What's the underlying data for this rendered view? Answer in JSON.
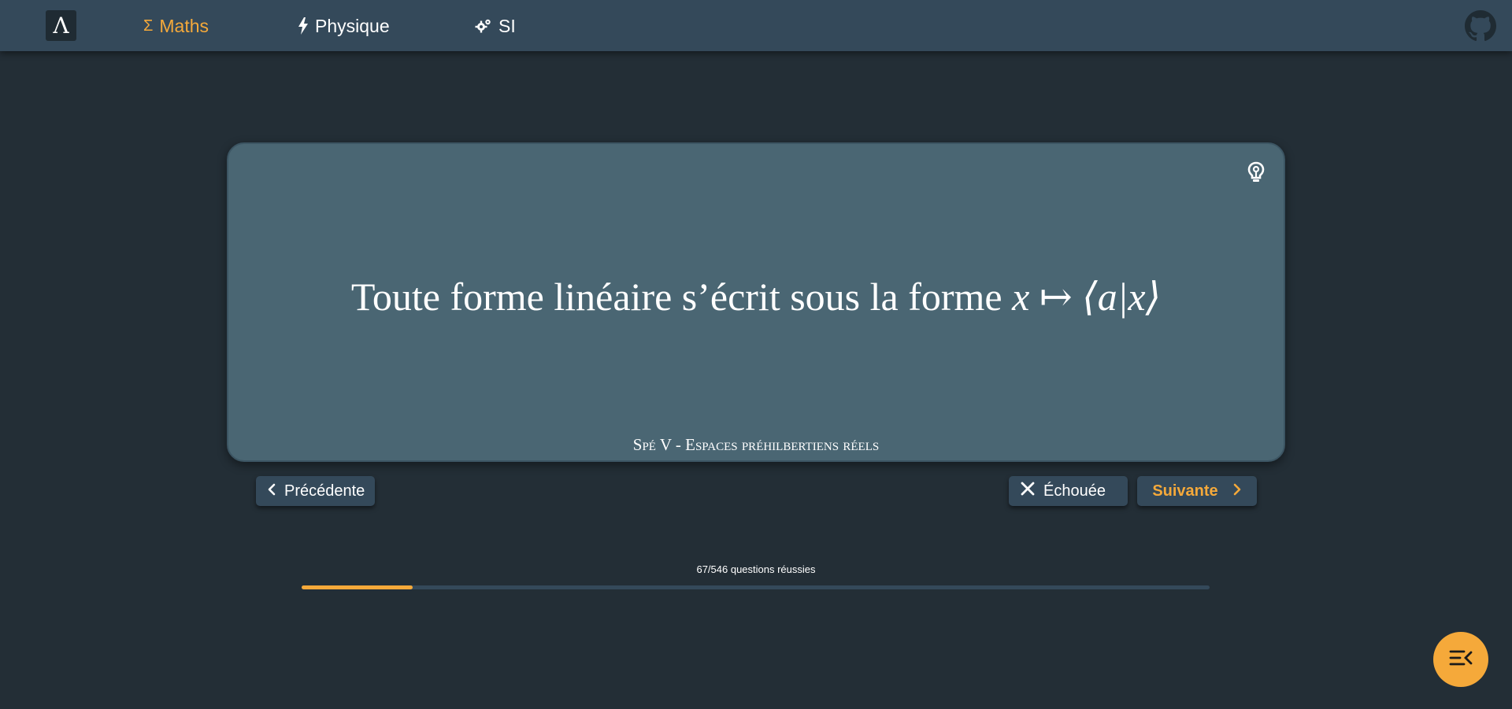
{
  "nav": {
    "logo": "Λ",
    "items": [
      {
        "label": "Maths",
        "icon": "sigma-icon",
        "glyph": "Σ",
        "active": true
      },
      {
        "label": "Physique",
        "icon": "lightning-icon",
        "glyph": "⚡",
        "active": false
      },
      {
        "label": "SI",
        "icon": "gears-icon",
        "glyph": "⚙",
        "active": false
      }
    ],
    "github_icon": "github-icon"
  },
  "card": {
    "statement_text": "Toute forme linéaire s’écrit sous la forme ",
    "statement_math": "x ↦ ⟨a|x⟩",
    "chapter": "Spé V - Espaces préhilbertiens réels",
    "hint_icon": "lightbulb-icon"
  },
  "buttons": {
    "previous": "Précédente",
    "failed": "Échouée",
    "next": "Suivante"
  },
  "progress": {
    "label": "67/546 questions réussies",
    "done": 67,
    "total": 546
  },
  "colors": {
    "accent": "#f5a93a",
    "navbar": "#34495a",
    "background": "#232e36",
    "card": "#4a6673"
  },
  "fab_icon": "menu-collapse-icon"
}
